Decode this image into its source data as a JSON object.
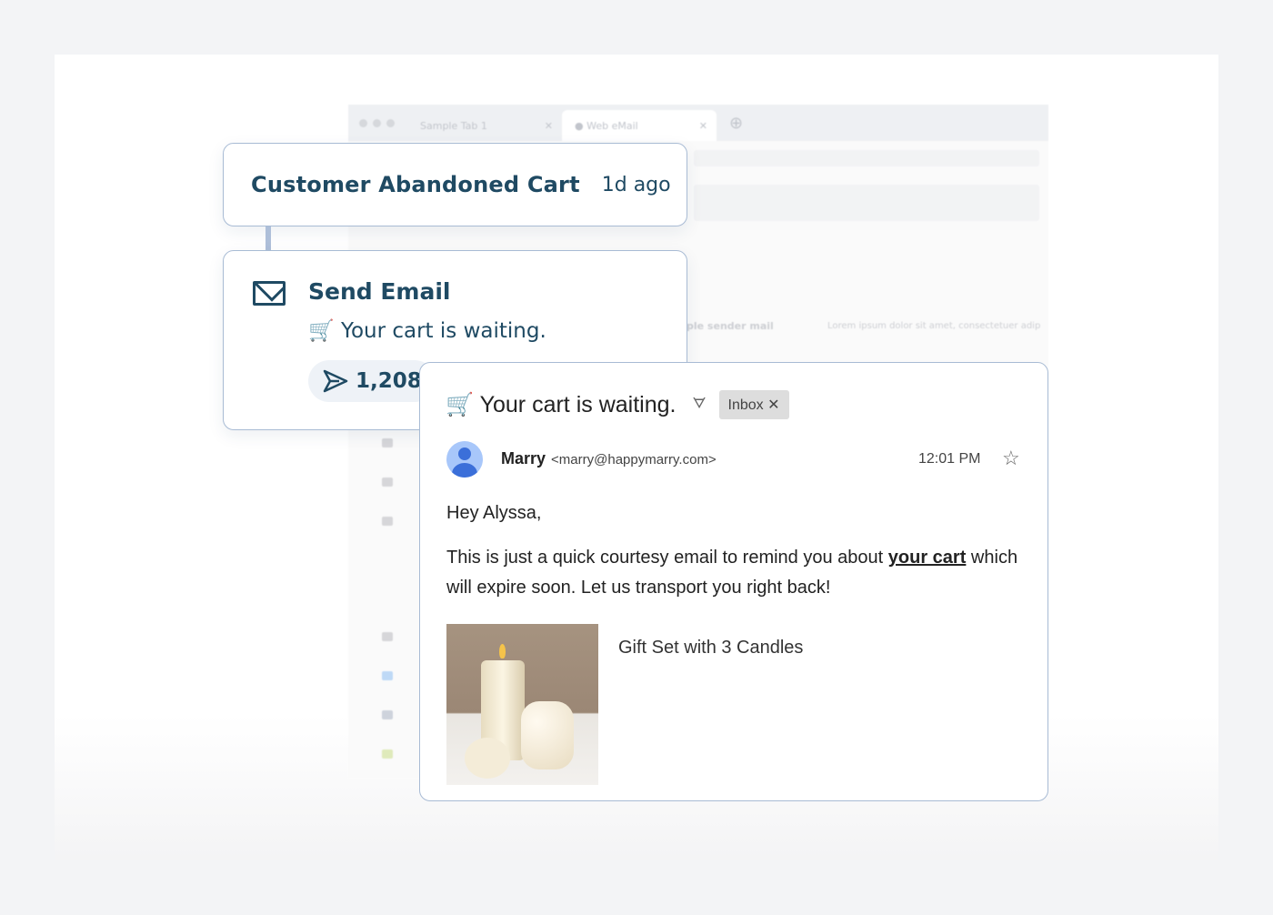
{
  "browser": {
    "tabs": [
      {
        "label": "Sample Tab 1"
      },
      {
        "label": "Web eMail"
      }
    ],
    "list_sender": "ple sender mail",
    "list_preview": "Lorem ipsum dolor sit amet, consectetuer adip"
  },
  "trigger": {
    "title": "Customer Abandoned Cart",
    "time": "1d ago"
  },
  "action": {
    "title": "Send Email",
    "subject": "🛒 Your cart is waiting.",
    "sent_count": "1,208"
  },
  "email": {
    "subject": "🛒 Your cart is waiting.",
    "label": "Inbox",
    "sender_name": "Marry",
    "sender_email": "<marry@happymarry.com>",
    "time": "12:01 PM",
    "greeting": "Hey Alyssa,",
    "body_before": "This is just a quick courtesy email to remind you about ",
    "link": "your cart",
    "body_after": " which will expire soon. Let us transport you right back!",
    "product_name": "Gift Set with 3 Candles"
  },
  "colors": {
    "card_text": "#1f4a63",
    "card_border": "#a8bbd4",
    "avatar": "#3b6fd9"
  }
}
